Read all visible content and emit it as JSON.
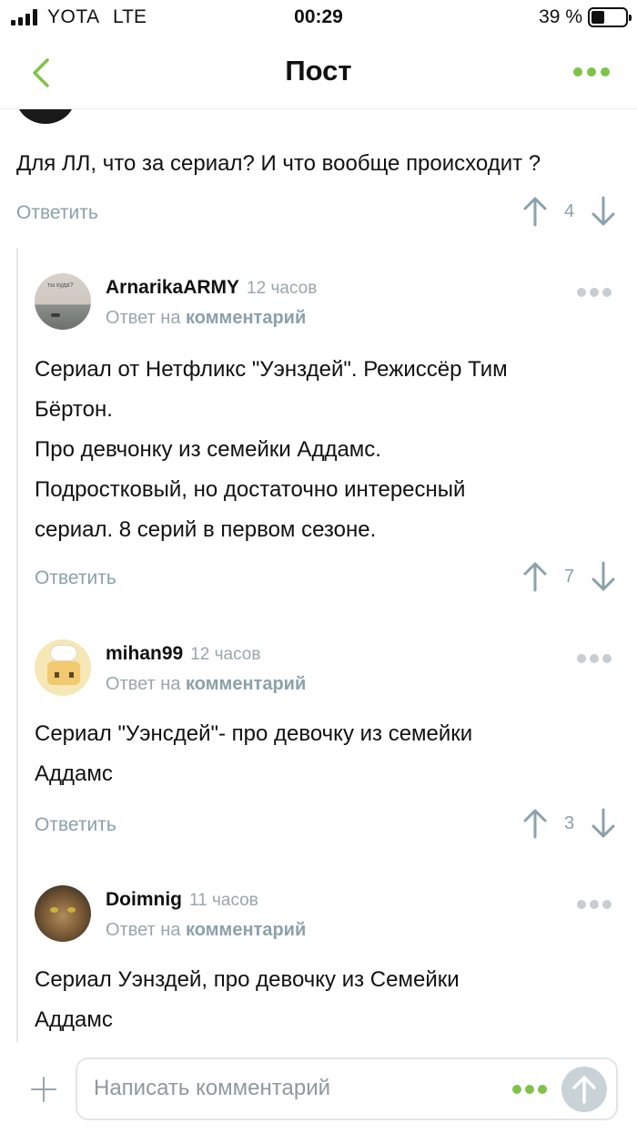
{
  "status_bar": {
    "carrier": "YOTA",
    "network": "LTE",
    "time": "00:29",
    "battery": "39 %",
    "battery_level_percent": 39
  },
  "header": {
    "title": "Пост"
  },
  "top_comment": {
    "text": "Для ЛЛ, что за сериал? И что вообще происходит ?",
    "reply_label": "Ответить",
    "rating": "4"
  },
  "replies": [
    {
      "author": "ArnarikaARMY",
      "time": "12 часов",
      "reply_prefix": "Ответ на",
      "reply_target": "комментарий",
      "avatar_caption": "ты куда?",
      "lines": [
        "Сериал от Нетфликс \"Уэнздей\". Режиссёр Тим",
        "Бёртон.",
        "Про девчонку из семейки Аддамс.",
        "Подростковый, но достаточно интересный",
        "сериал. 8 серий в первом сезоне."
      ],
      "reply_label": "Ответить",
      "rating": "7"
    },
    {
      "author": "mihan99",
      "time": "12 часов",
      "reply_prefix": "Ответ на",
      "reply_target": "комментарий",
      "lines": [
        "Сериал \"Уэнсдей\"- про девочку из семейки",
        "Аддамс"
      ],
      "reply_label": "Ответить",
      "rating": "3"
    },
    {
      "author": "Doimnig",
      "time": "11 часов",
      "reply_prefix": "Ответ на",
      "reply_target": "комментарий",
      "lines": [
        "Сериал Уэнздей, про девочку из Семейки",
        "Аддамс"
      ]
    }
  ],
  "composer": {
    "placeholder": "Написать комментарий"
  },
  "colors": {
    "accent_green": "#7ec347",
    "muted_blue_gray": "#8ba1ab",
    "thread_line": "#e4e6e8"
  }
}
